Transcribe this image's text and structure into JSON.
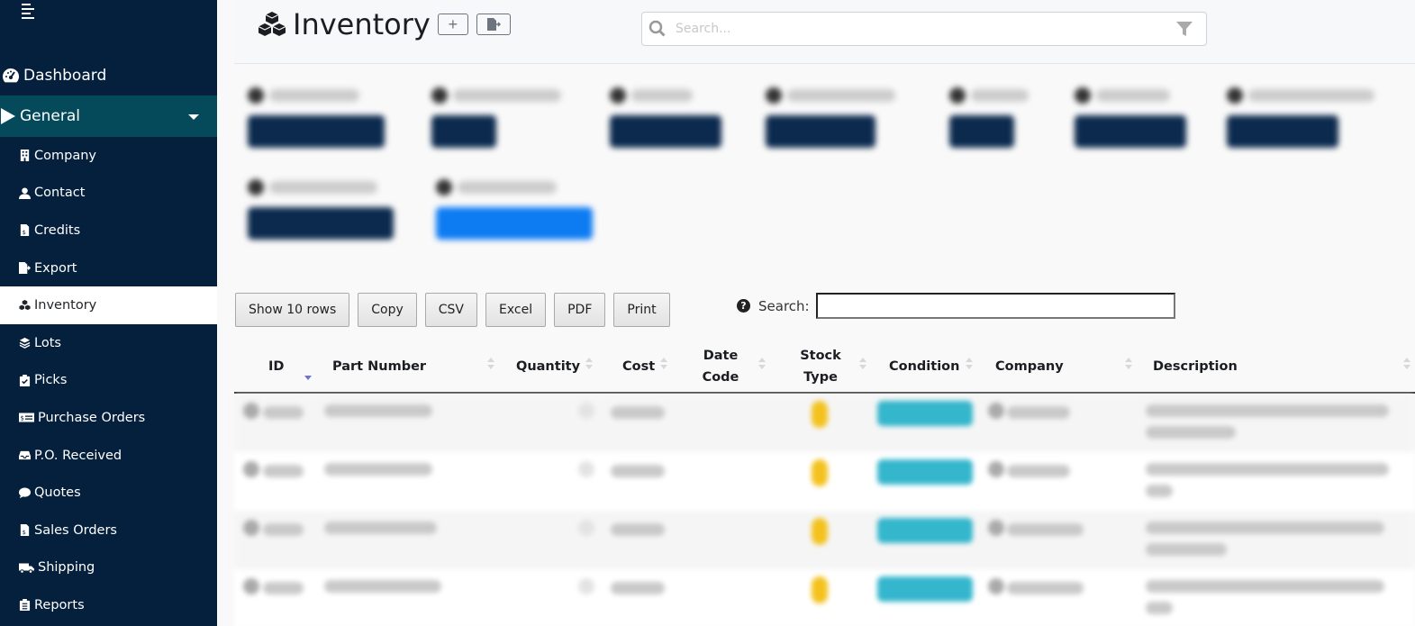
{
  "sidebar": {
    "dashboard": {
      "label": "Dashboard",
      "icon": "gauge-icon"
    },
    "general": {
      "label": "General",
      "icon": "play-icon"
    },
    "items": [
      {
        "label": "Company",
        "icon": "building-icon",
        "active": false
      },
      {
        "label": "Contact",
        "icon": "user-icon",
        "active": false
      },
      {
        "label": "Credits",
        "icon": "file-invoice-dollar-icon",
        "active": false
      },
      {
        "label": "Export",
        "icon": "file-export-icon",
        "active": false
      },
      {
        "label": "Inventory",
        "icon": "cubes-icon",
        "active": true
      },
      {
        "label": "Lots",
        "icon": "layer-group-icon",
        "active": false
      },
      {
        "label": "Picks",
        "icon": "clipboard-check-icon",
        "active": false
      },
      {
        "label": "Purchase Orders",
        "icon": "money-check-icon",
        "active": false
      },
      {
        "label": "P.O. Received",
        "icon": "inbox-icon",
        "active": false
      },
      {
        "label": "Quotes",
        "icon": "comment-icon",
        "active": false
      },
      {
        "label": "Sales Orders",
        "icon": "file-invoice-dollar-icon",
        "active": false
      },
      {
        "label": "Shipping",
        "icon": "truck-icon",
        "active": false
      },
      {
        "label": "Reports",
        "icon": "clipboard-list-icon",
        "active": false
      }
    ]
  },
  "header": {
    "title": "Inventory",
    "add_button": "+",
    "search_placeholder": "Search..."
  },
  "colors": {
    "sidebar_bg": "#05203c",
    "general_bg": "#054a5a",
    "filter_button": "#0c2a4e",
    "filter_button_active": "#0d7cf2",
    "stock_type_badge": "#f4c21e",
    "condition_badge": "#34b6cc",
    "sort_active": "#6e73d0"
  },
  "toolbar": {
    "buttons": [
      "Show 10 rows",
      "Copy",
      "CSV",
      "Excel",
      "PDF",
      "Print"
    ],
    "search_label": "Search:",
    "search_value": ""
  },
  "table": {
    "columns": [
      {
        "label": "ID",
        "sort": "desc"
      },
      {
        "label": "Part Number",
        "sort": "none"
      },
      {
        "label": "Quantity",
        "sort": "none"
      },
      {
        "label": "Cost",
        "sort": "none"
      },
      {
        "label": "Date Code",
        "sort": "none"
      },
      {
        "label": "Stock Type",
        "sort": "none"
      },
      {
        "label": "Condition",
        "sort": "none"
      },
      {
        "label": "Company",
        "sort": "none"
      },
      {
        "label": "Description",
        "sort": "none"
      }
    ],
    "row_count_visible": 4
  }
}
